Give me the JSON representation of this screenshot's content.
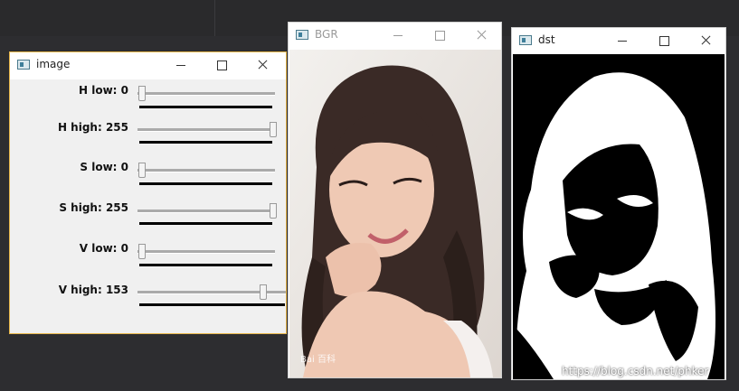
{
  "windows": {
    "image": {
      "title": "image",
      "trackbars": [
        {
          "label": "H low: 0",
          "value": 0,
          "max": 255
        },
        {
          "label": "H high: 255",
          "value": 255,
          "max": 255
        },
        {
          "label": "S low: 0",
          "value": 0,
          "max": 255
        },
        {
          "label": "S high: 255",
          "value": 255,
          "max": 255
        },
        {
          "label": "V low: 0",
          "value": 0,
          "max": 255
        },
        {
          "label": "V high: 153",
          "value": 153,
          "max": 255
        }
      ]
    },
    "bgr": {
      "title": "BGR",
      "watermark": "Bai 百科"
    },
    "dst": {
      "title": "dst"
    }
  },
  "watermark_url": "https://blog.csdn.net/phker",
  "colors": {
    "active_border": "#e8b74a",
    "trackbar_bg": "#f0f0f0",
    "mask_fg": "#ffffff",
    "mask_bg": "#000000"
  },
  "icons": [
    "app-window-icon",
    "minimize-icon",
    "maximize-icon",
    "close-icon"
  ]
}
